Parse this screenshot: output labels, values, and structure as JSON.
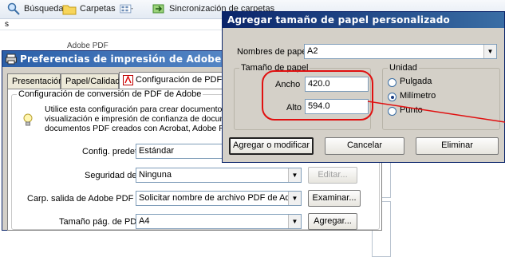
{
  "explorer": {
    "toolbar": {
      "search_label": "Búsqueda",
      "folders_label": "Carpetas",
      "sync_label": "Sincronización de carpetas"
    },
    "path_text": "s",
    "background_label": "Adobe PDF"
  },
  "preferences_window": {
    "title": "Preferencias de impresión de Adobe PDF",
    "tabs": [
      {
        "label": "Presentación"
      },
      {
        "label": "Papel/Calidad"
      },
      {
        "label": "Configuración de PDF d"
      }
    ],
    "section_title": "Configuración de conversión de PDF de Adobe",
    "info_text": "Utilice esta configuración para crear documentos de Adobe PDF adecuados para la visualización e impresión de confianza de documentos de empresa. Se pueden abrir los documentos PDF creados con Acrobat, Adobe Reader",
    "rows": {
      "default_settings": {
        "label": "Config. predet.:",
        "value": "Estándar"
      },
      "security": {
        "label": "Seguridad de PDF:",
        "value": "Ninguna",
        "button": "Editar..."
      },
      "output_folder": {
        "label": "Carp. salida de Adobe PDF",
        "value": "Solicitar nombre de archivo PDF de Adobe",
        "button": "Examinar..."
      },
      "page_size": {
        "label": "Tamaño pág. de PDF:",
        "value": "A4",
        "button": "Agregar..."
      }
    }
  },
  "custom_paper_dialog": {
    "title": "Agregar tamaño de papel personalizado",
    "paper_name_label": "Nombres de papel:",
    "paper_name_value": "A2",
    "paper_size_group": "Tamaño de papel",
    "width_label": "Ancho",
    "width_value": "420.0",
    "height_label": "Alto",
    "height_value": "594.0",
    "unit_group": "Unidad",
    "units": [
      "Pulgada",
      "Milímetro",
      "Punto"
    ],
    "selected_unit": "Milímetro",
    "buttons": {
      "add_modify": "Agregar o modificar",
      "cancel": "Cancelar",
      "delete": "Eliminar"
    }
  },
  "annotation": {
    "color": "#e01010"
  },
  "colors": {
    "title_active": "#0a246a",
    "dialog_face": "#d4d0c8"
  }
}
